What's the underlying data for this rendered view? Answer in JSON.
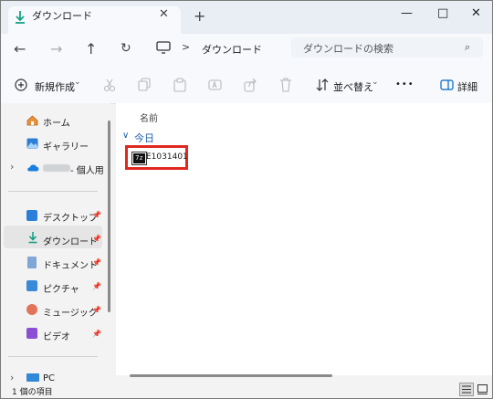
{
  "window": {
    "tab_title": "ダウンロード",
    "close_tab_glyph": "✕",
    "new_tab_glyph": "+",
    "controls": {
      "minimize": "—",
      "maximize": "□",
      "close": "✕"
    }
  },
  "navigation": {
    "back": "←",
    "forward": "→",
    "up": "↑",
    "refresh": "↻",
    "address": "ダウンロード",
    "address_separator": ">",
    "search_placeholder": "ダウンロードの検索",
    "search_icon": "⌕"
  },
  "toolbar": {
    "new_label": "新規作成",
    "sort_label": "並べ替え",
    "more_label": "•••",
    "details_label": "詳細",
    "dropdown_glyph": "⌄",
    "icons": [
      "cut-icon",
      "copy-icon",
      "paste-icon",
      "rename-icon",
      "share-icon",
      "delete-icon"
    ]
  },
  "sidebar": {
    "home": "ホーム",
    "gallery": "ギャラリー",
    "onedrive_suffix": "- 個人用",
    "pinned": [
      "デスクトップ",
      "ダウンロード",
      "ドキュメント",
      "ピクチャ",
      "ミュージック",
      "ビデオ"
    ],
    "pc": "PC",
    "expand_glyph": "›"
  },
  "content": {
    "column_name": "名前",
    "group_label": "今日",
    "group_toggle": "∨",
    "file_name": "E1031401",
    "file_icon_text": "7z"
  },
  "status": {
    "item_count": "1 個の項目"
  },
  "colors": {
    "accent": "#0067c0",
    "highlight_box": "#e0281f",
    "selected_sidebar": "#e5e5e5"
  }
}
